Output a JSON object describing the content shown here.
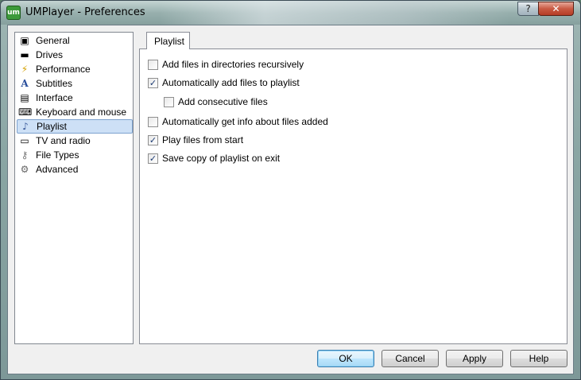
{
  "window": {
    "title": "UMPlayer - Preferences",
    "app_icon_text": "um",
    "caption": {
      "help": "?",
      "close": "✕"
    }
  },
  "sidebar": {
    "items": [
      {
        "label": "General",
        "icon": "general-icon",
        "glyph": "▣"
      },
      {
        "label": "Drives",
        "icon": "drive-icon",
        "glyph": "▬"
      },
      {
        "label": "Performance",
        "icon": "lightning-icon",
        "glyph": "⚡"
      },
      {
        "label": "Subtitles",
        "icon": "subtitles-icon",
        "glyph": "A"
      },
      {
        "label": "Interface",
        "icon": "interface-icon",
        "glyph": "▤"
      },
      {
        "label": "Keyboard and mouse",
        "icon": "keyboard-icon",
        "glyph": "⌨"
      },
      {
        "label": "Playlist",
        "icon": "playlist-icon",
        "glyph": "♪"
      },
      {
        "label": "TV and radio",
        "icon": "tv-icon",
        "glyph": "▭"
      },
      {
        "label": "File Types",
        "icon": "file-types-icon",
        "glyph": "⚷"
      },
      {
        "label": "Advanced",
        "icon": "gear-icon",
        "glyph": "⚙"
      }
    ],
    "selected": "Playlist"
  },
  "tab": {
    "label": "Playlist"
  },
  "options": [
    {
      "label": "Add files in directories recursively",
      "checked": false
    },
    {
      "label": "Automatically add files to playlist",
      "checked": true
    },
    {
      "label": "Add consecutive files",
      "checked": false
    },
    {
      "label": "Automatically get info about files added",
      "checked": false
    },
    {
      "label": "Play files from start",
      "checked": true
    },
    {
      "label": "Save copy of playlist on exit",
      "checked": true
    }
  ],
  "buttons": {
    "ok": "OK",
    "cancel": "Cancel",
    "apply": "Apply",
    "help": "Help"
  },
  "colors": {
    "selection": "#cde0f6",
    "checkmark": "#1c3b73"
  }
}
